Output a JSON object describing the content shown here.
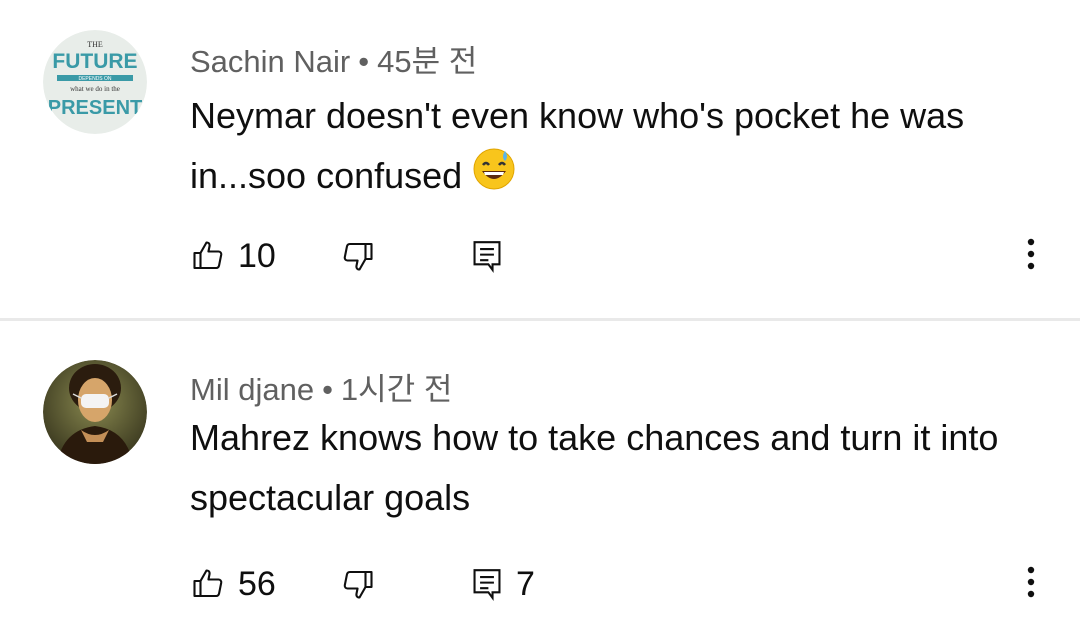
{
  "comments": [
    {
      "author": "Sachin Nair",
      "separator": "•",
      "time": "45분 전",
      "text": "Neymar doesn't even know who's pocket he was in...soo confused",
      "emoji": "grinning-sweat-emoji",
      "likes": "10",
      "replies": "",
      "avatar": {
        "line1": "THE",
        "line2": "FUTURE",
        "line3": "DEPENDS ON",
        "line4": "what we do in the",
        "line5": "PRESENT"
      }
    },
    {
      "author": "Mil djane",
      "separator": "•",
      "time": "1시간 전",
      "text": "Mahrez knows how to take chances and turn it into spectacular goals",
      "likes": "56",
      "replies": "7",
      "avatar": {}
    }
  ],
  "icons": {
    "like": "thumb-up-icon",
    "dislike": "thumb-down-icon",
    "reply": "reply-icon",
    "more": "more-vertical-icon"
  },
  "colors": {
    "meta_text": "#606060",
    "body_text": "#0f0f0f",
    "divider": "#e9e9e9",
    "avatar_teal": "#3a9aa7"
  }
}
